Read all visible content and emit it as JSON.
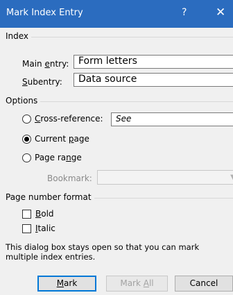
{
  "window": {
    "title": "Mark Index Entry",
    "help_glyph": "?",
    "close_glyph": "✕"
  },
  "index": {
    "heading": "Index",
    "main_entry": {
      "label_pre": "Main ",
      "label_accel": "e",
      "label_post": "ntry:",
      "value": "Form letters"
    },
    "subentry": {
      "label_accel": "S",
      "label_post": "ubentry:",
      "value": "Data source"
    }
  },
  "options": {
    "heading": "Options",
    "cross_reference": {
      "label_accel": "C",
      "label_post": "ross-reference:",
      "value": "See",
      "selected": false
    },
    "current_page": {
      "label_pre": "Current ",
      "label_accel": "p",
      "label_post": "age",
      "selected": true
    },
    "page_range": {
      "label_pre": "Page ra",
      "label_accel": "n",
      "label_post": "ge",
      "selected": false
    },
    "bookmark": {
      "label": "Bookmark:",
      "value": ""
    }
  },
  "page_number_format": {
    "heading": "Page number format",
    "bold": {
      "label_accel": "B",
      "label_post": "old",
      "checked": false
    },
    "italic": {
      "label_accel": "I",
      "label_post": "talic",
      "checked": false
    }
  },
  "info": {
    "line1": "This dialog box stays open so that you can mark",
    "line2": "multiple index entries."
  },
  "buttons": {
    "mark": {
      "label_accel": "M",
      "label_post": "ark"
    },
    "mark_all": {
      "label_pre": "Mark ",
      "label_accel": "A",
      "label_post": "ll"
    },
    "cancel": {
      "label": "Cancel"
    }
  }
}
